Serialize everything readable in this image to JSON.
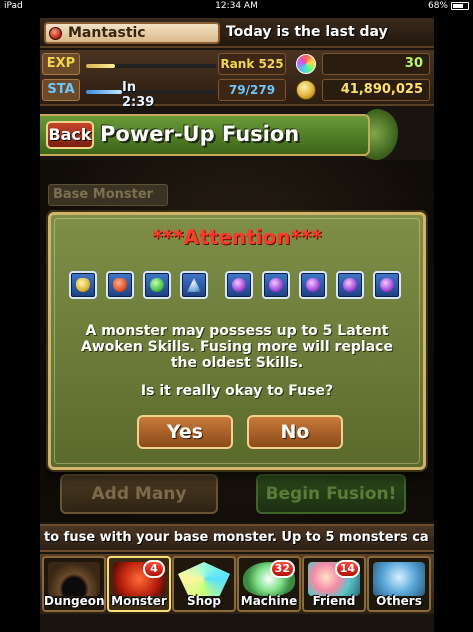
{
  "status_bar": {
    "device": "iPad",
    "time": "12:34 AM",
    "battery": "68%"
  },
  "player": {
    "name": "Mantastic",
    "ticker": "Today is the last day"
  },
  "stats": {
    "exp_label": "EXP",
    "exp_fill": 0.22,
    "rank": "Rank 525",
    "magic_stones": "30",
    "sta_label": "STA",
    "sta_fill": 0.28,
    "sta_timer": "In 2:39",
    "stamina": "79/279",
    "coins": "41,890,025"
  },
  "header": {
    "back_label": "Back",
    "title": "Power-Up Fusion"
  },
  "background": {
    "base_monster_label": "Base Monster",
    "add_many_label": "Add Many",
    "begin_fusion_label": "Begin Fusion!"
  },
  "dialog": {
    "title": "***Attention***",
    "awoken_icons": [
      "yellow",
      "red",
      "green",
      "blue",
      "purple",
      "purple",
      "purple",
      "purple",
      "purple"
    ],
    "message": "A monster may possess up to 5 Latent Awoken Skills. Fusing more will replace the oldest Skills.",
    "question": "Is it really okay to Fuse?",
    "yes_label": "Yes",
    "no_label": "No"
  },
  "help_ticker": "to fuse with your base monster. Up to 5 monsters ca",
  "nav": {
    "items": [
      {
        "label": "Dungeon",
        "badge": ""
      },
      {
        "label": "Monster",
        "badge": "4"
      },
      {
        "label": "Shop",
        "badge": ""
      },
      {
        "label": "Machine",
        "badge": "32"
      },
      {
        "label": "Friend",
        "badge": "14"
      },
      {
        "label": "Others",
        "badge": ""
      }
    ]
  }
}
